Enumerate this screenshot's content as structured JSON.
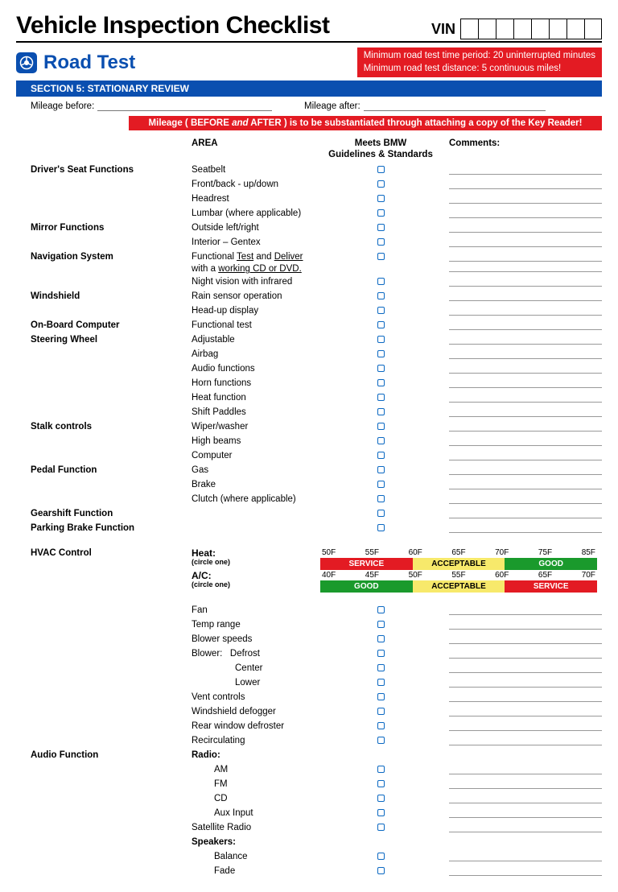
{
  "title": "Vehicle Inspection Checklist",
  "vin_label": "VIN",
  "vin_box_count": 8,
  "road_test_label": "Road Test",
  "road_warning_line1": "Minimum road test time period: 20 uninterrupted minutes",
  "road_warning_line2": "Minimum road test distance: 5 continuous miles!",
  "section_bar": "SECTION 5: STATIONARY REVIEW",
  "mileage_before_label": "Mileage before:",
  "mileage_after_label": "Mileage after:",
  "red_bar_prefix": "Mileage ( BEFORE ",
  "red_bar_em": "and",
  "red_bar_suffix": " AFTER ) is to be substantiated through attaching a copy of the Key Reader!",
  "headers": {
    "area": "AREA",
    "meets_line1": "Meets BMW",
    "meets_line2": "Guidelines & Standards",
    "comments": "Comments:"
  },
  "groups_main": [
    {
      "area": "Driver's Seat Functions",
      "items": [
        {
          "label": "Seatbelt"
        },
        {
          "label": "Front/back - up/down"
        },
        {
          "label": "Headrest"
        },
        {
          "label": "Lumbar (where applicable)"
        }
      ]
    },
    {
      "area": "Mirror Functions",
      "items": [
        {
          "label": "Outside left/right"
        },
        {
          "label": "Interior – Gentex"
        }
      ]
    },
    {
      "area": "Navigation System",
      "items": [
        {
          "html": "Functional <span class='under'>Test</span> and <span class='under'>Deliver</span> with a <span class='under'>working CD or DVD.</span>",
          "tall": true
        },
        {
          "label": "Night vision with infrared"
        }
      ]
    },
    {
      "area": "Windshield",
      "items": [
        {
          "label": "Rain sensor operation"
        },
        {
          "label": "Head-up display"
        }
      ]
    },
    {
      "area": "On-Board Computer",
      "items": [
        {
          "label": "Functional test"
        }
      ]
    },
    {
      "area": "Steering Wheel",
      "items": [
        {
          "label": "Adjustable"
        },
        {
          "label": "Airbag"
        },
        {
          "label": "Audio functions"
        },
        {
          "label": "Horn functions"
        },
        {
          "label": "Heat function"
        },
        {
          "label": "Shift Paddles"
        }
      ]
    },
    {
      "area": "Stalk controls",
      "items": [
        {
          "label": "Wiper/washer"
        },
        {
          "label": "High beams"
        },
        {
          "label": "Computer"
        }
      ]
    },
    {
      "area": "Pedal Function",
      "items": [
        {
          "label": "Gas"
        },
        {
          "label": "Brake"
        },
        {
          "label": "Clutch (where applicable)"
        }
      ]
    },
    {
      "area": "Gearshift Function",
      "items": [
        {
          "label": ""
        }
      ]
    },
    {
      "area": "Parking Brake Function",
      "items": [
        {
          "label": ""
        }
      ]
    }
  ],
  "hvac": {
    "area_label": "HVAC Control",
    "heat": {
      "label": "Heat:",
      "sub": "(circle one)",
      "ticks": [
        "50F",
        "55F",
        "60F",
        "65F",
        "70F",
        "75F",
        "85F"
      ],
      "segments": [
        {
          "label": "SERVICE",
          "class": "seg-service"
        },
        {
          "label": "ACCEPTABLE",
          "class": "seg-acceptable"
        },
        {
          "label": "GOOD",
          "class": "seg-good"
        }
      ]
    },
    "ac": {
      "label": "A/C:",
      "sub": "(circle one)",
      "ticks": [
        "40F",
        "45F",
        "50F",
        "55F",
        "60F",
        "65F",
        "70F"
      ],
      "segments": [
        {
          "label": "GOOD",
          "class": "seg-good"
        },
        {
          "label": "ACCEPTABLE",
          "class": "seg-acceptable"
        },
        {
          "label": "SERVICE",
          "class": "seg-service"
        }
      ]
    }
  },
  "groups_after_hvac": [
    {
      "area": "",
      "items": [
        {
          "label": "Fan"
        },
        {
          "label": "Temp range"
        },
        {
          "label": "Blower speeds"
        },
        {
          "html": "Blower:&nbsp;&nbsp;&nbsp;Defrost"
        },
        {
          "html": "<span class='indent'></span>Center"
        },
        {
          "html": "<span class='indent'></span>Lower"
        },
        {
          "label": "Vent controls"
        },
        {
          "label": "Windshield defogger"
        },
        {
          "label": "Rear window defroster"
        },
        {
          "label": "Recirculating"
        }
      ]
    },
    {
      "area": "Audio Function",
      "items": [
        {
          "label": "Radio:",
          "bold": true,
          "nocb": true,
          "nocomment": true
        },
        {
          "html": "<span class='indent' style='width:28px'></span>AM"
        },
        {
          "html": "<span class='indent' style='width:28px'></span>FM"
        },
        {
          "html": "<span class='indent' style='width:28px'></span>CD"
        },
        {
          "html": "<span class='indent' style='width:28px'></span>Aux Input"
        },
        {
          "label": "Satellite Radio"
        },
        {
          "label": "Speakers:",
          "bold": true,
          "nocb": true,
          "nocomment": true
        },
        {
          "html": "<span class='indent' style='width:28px'></span>Balance"
        },
        {
          "html": "<span class='indent' style='width:28px'></span>Fade"
        }
      ]
    }
  ]
}
